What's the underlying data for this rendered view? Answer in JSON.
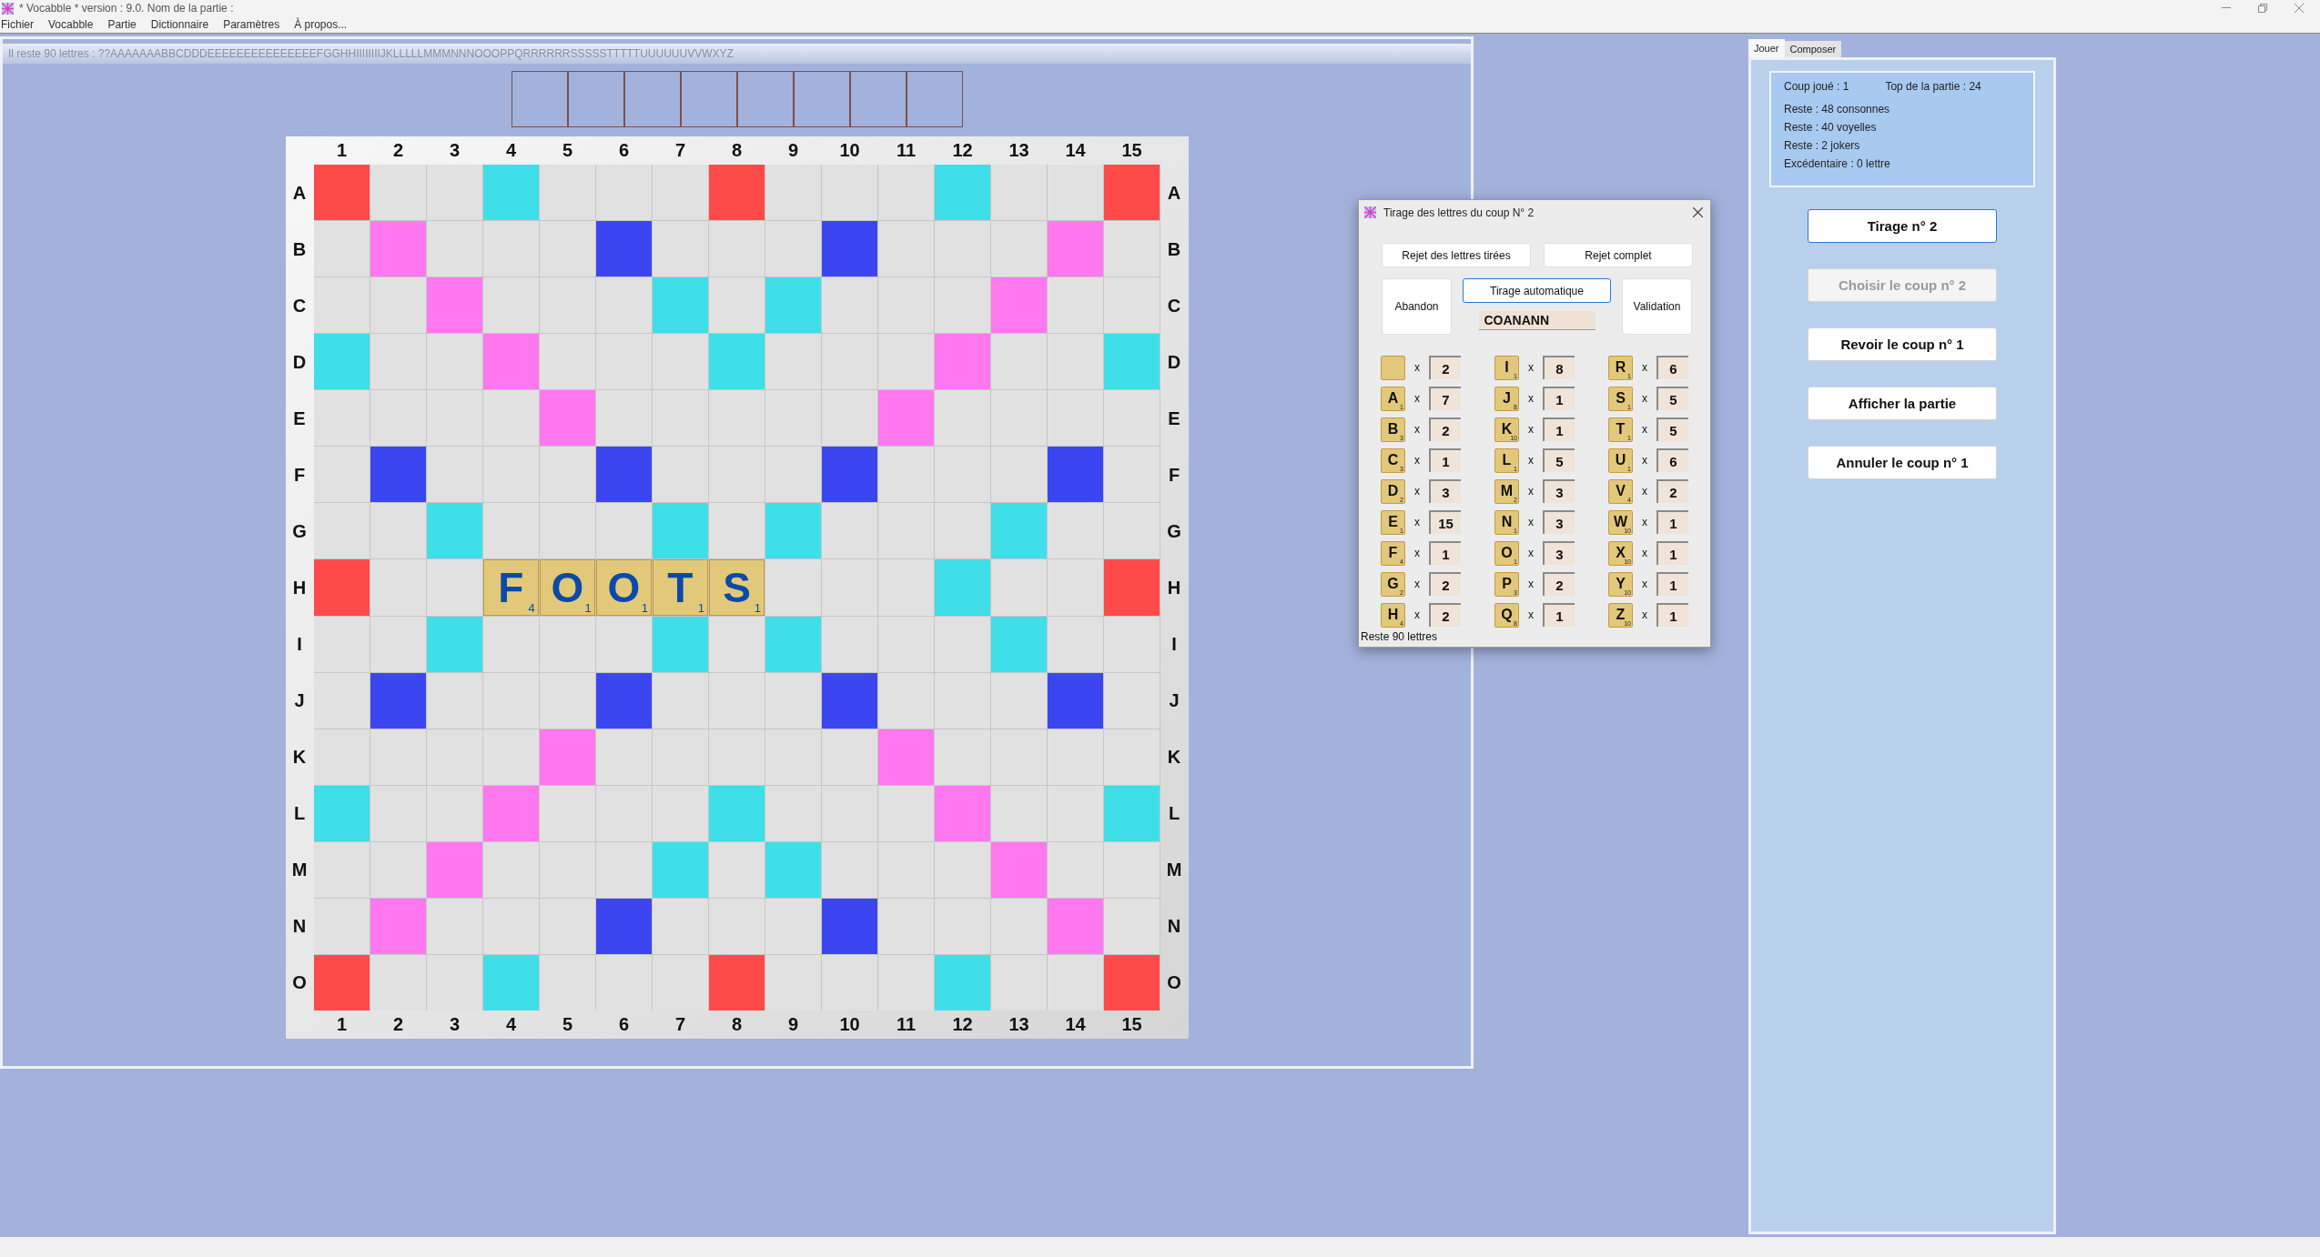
{
  "window": {
    "title": "* Vocabble * version : 9.0. Nom de la partie :"
  },
  "menu": [
    "Fichier",
    "Vocabble",
    "Partie",
    "Dictionnaire",
    "Paramètres",
    "À propos..."
  ],
  "remaining_letters": "Il reste 90 lettres : ??AAAAAAABBCDDDEEEEEEEEEEEEEEEFGGHHIIIIIIIIJKLLLLLMMMNNNOOOPPQRRRRRRSSSSSTTTTTUUUUUUVVWXYZ",
  "rack_slots": [
    {
      "kind": "empty"
    },
    {
      "kind": "empty"
    },
    {
      "kind": "empty"
    },
    {
      "kind": "empty"
    },
    {
      "kind": "empty"
    },
    {
      "kind": "empty"
    },
    {
      "kind": "empty"
    },
    {
      "kind": "empty"
    }
  ],
  "board": {
    "top_labels": [
      "1",
      "2",
      "3",
      "4",
      "5",
      "6",
      "7",
      "8",
      "9",
      "10",
      "11",
      "12",
      "13",
      "14",
      "15"
    ],
    "bottom_labels": [
      "1",
      "2",
      "3",
      "4",
      "5",
      "6",
      "7",
      "8",
      "9",
      "10",
      "11",
      "12",
      "13",
      "14",
      "15"
    ],
    "rows": [
      {
        "label_left": "A",
        "label_right": "A",
        "cells": [
          {
            "kind": "tw"
          },
          {
            "kind": "n"
          },
          {
            "kind": "n"
          },
          {
            "kind": "dl"
          },
          {
            "kind": "n"
          },
          {
            "kind": "n"
          },
          {
            "kind": "n"
          },
          {
            "kind": "tw"
          },
          {
            "kind": "n"
          },
          {
            "kind": "n"
          },
          {
            "kind": "n"
          },
          {
            "kind": "dl"
          },
          {
            "kind": "n"
          },
          {
            "kind": "n"
          },
          {
            "kind": "tw"
          }
        ]
      },
      {
        "label_left": "B",
        "label_right": "B",
        "cells": [
          {
            "kind": "n"
          },
          {
            "kind": "dw"
          },
          {
            "kind": "n"
          },
          {
            "kind": "n"
          },
          {
            "kind": "n"
          },
          {
            "kind": "tl"
          },
          {
            "kind": "n"
          },
          {
            "kind": "n"
          },
          {
            "kind": "n"
          },
          {
            "kind": "tl"
          },
          {
            "kind": "n"
          },
          {
            "kind": "n"
          },
          {
            "kind": "n"
          },
          {
            "kind": "dw"
          },
          {
            "kind": "n"
          }
        ]
      },
      {
        "label_left": "C",
        "label_right": "C",
        "cells": [
          {
            "kind": "n"
          },
          {
            "kind": "n"
          },
          {
            "kind": "dw"
          },
          {
            "kind": "n"
          },
          {
            "kind": "n"
          },
          {
            "kind": "n"
          },
          {
            "kind": "dl"
          },
          {
            "kind": "n"
          },
          {
            "kind": "dl"
          },
          {
            "kind": "n"
          },
          {
            "kind": "n"
          },
          {
            "kind": "n"
          },
          {
            "kind": "dw"
          },
          {
            "kind": "n"
          },
          {
            "kind": "n"
          }
        ]
      },
      {
        "label_left": "D",
        "label_right": "D",
        "cells": [
          {
            "kind": "dl"
          },
          {
            "kind": "n"
          },
          {
            "kind": "n"
          },
          {
            "kind": "dw"
          },
          {
            "kind": "n"
          },
          {
            "kind": "n"
          },
          {
            "kind": "n"
          },
          {
            "kind": "dl"
          },
          {
            "kind": "n"
          },
          {
            "kind": "n"
          },
          {
            "kind": "n"
          },
          {
            "kind": "dw"
          },
          {
            "kind": "n"
          },
          {
            "kind": "n"
          },
          {
            "kind": "dl"
          }
        ]
      },
      {
        "label_left": "E",
        "label_right": "E",
        "cells": [
          {
            "kind": "n"
          },
          {
            "kind": "n"
          },
          {
            "kind": "n"
          },
          {
            "kind": "n"
          },
          {
            "kind": "dw"
          },
          {
            "kind": "n"
          },
          {
            "kind": "n"
          },
          {
            "kind": "n"
          },
          {
            "kind": "n"
          },
          {
            "kind": "n"
          },
          {
            "kind": "dw"
          },
          {
            "kind": "n"
          },
          {
            "kind": "n"
          },
          {
            "kind": "n"
          },
          {
            "kind": "n"
          }
        ]
      },
      {
        "label_left": "F",
        "label_right": "F",
        "cells": [
          {
            "kind": "n"
          },
          {
            "kind": "tl"
          },
          {
            "kind": "n"
          },
          {
            "kind": "n"
          },
          {
            "kind": "n"
          },
          {
            "kind": "tl"
          },
          {
            "kind": "n"
          },
          {
            "kind": "n"
          },
          {
            "kind": "n"
          },
          {
            "kind": "tl"
          },
          {
            "kind": "n"
          },
          {
            "kind": "n"
          },
          {
            "kind": "n"
          },
          {
            "kind": "tl"
          },
          {
            "kind": "n"
          }
        ]
      },
      {
        "label_left": "G",
        "label_right": "G",
        "cells": [
          {
            "kind": "n"
          },
          {
            "kind": "n"
          },
          {
            "kind": "dl"
          },
          {
            "kind": "n"
          },
          {
            "kind": "n"
          },
          {
            "kind": "n"
          },
          {
            "kind": "dl"
          },
          {
            "kind": "n"
          },
          {
            "kind": "dl"
          },
          {
            "kind": "n"
          },
          {
            "kind": "n"
          },
          {
            "kind": "n"
          },
          {
            "kind": "dl"
          },
          {
            "kind": "n"
          },
          {
            "kind": "n"
          }
        ]
      },
      {
        "label_left": "H",
        "label_right": "H",
        "cells": [
          {
            "kind": "tw"
          },
          {
            "kind": "n"
          },
          {
            "kind": "n"
          },
          {
            "kind": "tile",
            "letter": "F",
            "points": "4"
          },
          {
            "kind": "tile",
            "letter": "O",
            "points": "1"
          },
          {
            "kind": "tile",
            "letter": "O",
            "points": "1"
          },
          {
            "kind": "tile",
            "letter": "T",
            "points": "1"
          },
          {
            "kind": "tile",
            "letter": "S",
            "points": "1"
          },
          {
            "kind": "n"
          },
          {
            "kind": "n"
          },
          {
            "kind": "n"
          },
          {
            "kind": "dl"
          },
          {
            "kind": "n"
          },
          {
            "kind": "n"
          },
          {
            "kind": "tw"
          }
        ]
      },
      {
        "label_left": "I",
        "label_right": "I",
        "cells": [
          {
            "kind": "n"
          },
          {
            "kind": "n"
          },
          {
            "kind": "dl"
          },
          {
            "kind": "n"
          },
          {
            "kind": "n"
          },
          {
            "kind": "n"
          },
          {
            "kind": "dl"
          },
          {
            "kind": "n"
          },
          {
            "kind": "dl"
          },
          {
            "kind": "n"
          },
          {
            "kind": "n"
          },
          {
            "kind": "n"
          },
          {
            "kind": "dl"
          },
          {
            "kind": "n"
          },
          {
            "kind": "n"
          }
        ]
      },
      {
        "label_left": "J",
        "label_right": "J",
        "cells": [
          {
            "kind": "n"
          },
          {
            "kind": "tl"
          },
          {
            "kind": "n"
          },
          {
            "kind": "n"
          },
          {
            "kind": "n"
          },
          {
            "kind": "tl"
          },
          {
            "kind": "n"
          },
          {
            "kind": "n"
          },
          {
            "kind": "n"
          },
          {
            "kind": "tl"
          },
          {
            "kind": "n"
          },
          {
            "kind": "n"
          },
          {
            "kind": "n"
          },
          {
            "kind": "tl"
          },
          {
            "kind": "n"
          }
        ]
      },
      {
        "label_left": "K",
        "label_right": "K",
        "cells": [
          {
            "kind": "n"
          },
          {
            "kind": "n"
          },
          {
            "kind": "n"
          },
          {
            "kind": "n"
          },
          {
            "kind": "dw"
          },
          {
            "kind": "n"
          },
          {
            "kind": "n"
          },
          {
            "kind": "n"
          },
          {
            "kind": "n"
          },
          {
            "kind": "n"
          },
          {
            "kind": "dw"
          },
          {
            "kind": "n"
          },
          {
            "kind": "n"
          },
          {
            "kind": "n"
          },
          {
            "kind": "n"
          }
        ]
      },
      {
        "label_left": "L",
        "label_right": "L",
        "cells": [
          {
            "kind": "dl"
          },
          {
            "kind": "n"
          },
          {
            "kind": "n"
          },
          {
            "kind": "dw"
          },
          {
            "kind": "n"
          },
          {
            "kind": "n"
          },
          {
            "kind": "n"
          },
          {
            "kind": "dl"
          },
          {
            "kind": "n"
          },
          {
            "kind": "n"
          },
          {
            "kind": "n"
          },
          {
            "kind": "dw"
          },
          {
            "kind": "n"
          },
          {
            "kind": "n"
          },
          {
            "kind": "dl"
          }
        ]
      },
      {
        "label_left": "M",
        "label_right": "M",
        "cells": [
          {
            "kind": "n"
          },
          {
            "kind": "n"
          },
          {
            "kind": "dw"
          },
          {
            "kind": "n"
          },
          {
            "kind": "n"
          },
          {
            "kind": "n"
          },
          {
            "kind": "dl"
          },
          {
            "kind": "n"
          },
          {
            "kind": "dl"
          },
          {
            "kind": "n"
          },
          {
            "kind": "n"
          },
          {
            "kind": "n"
          },
          {
            "kind": "dw"
          },
          {
            "kind": "n"
          },
          {
            "kind": "n"
          }
        ]
      },
      {
        "label_left": "N",
        "label_right": "N",
        "cells": [
          {
            "kind": "n"
          },
          {
            "kind": "dw"
          },
          {
            "kind": "n"
          },
          {
            "kind": "n"
          },
          {
            "kind": "n"
          },
          {
            "kind": "tl"
          },
          {
            "kind": "n"
          },
          {
            "kind": "n"
          },
          {
            "kind": "n"
          },
          {
            "kind": "tl"
          },
          {
            "kind": "n"
          },
          {
            "kind": "n"
          },
          {
            "kind": "n"
          },
          {
            "kind": "dw"
          },
          {
            "kind": "n"
          }
        ]
      },
      {
        "label_left": "O",
        "label_right": "O",
        "cells": [
          {
            "kind": "tw"
          },
          {
            "kind": "n"
          },
          {
            "kind": "n"
          },
          {
            "kind": "dl"
          },
          {
            "kind": "n"
          },
          {
            "kind": "n"
          },
          {
            "kind": "n"
          },
          {
            "kind": "tw"
          },
          {
            "kind": "n"
          },
          {
            "kind": "n"
          },
          {
            "kind": "n"
          },
          {
            "kind": "dl"
          },
          {
            "kind": "n"
          },
          {
            "kind": "n"
          },
          {
            "kind": "tw"
          }
        ]
      }
    ]
  },
  "dialog": {
    "title": "Tirage des lettres du coup N° 2",
    "buttons": [
      {
        "label": "Rejet des lettres tirées",
        "focused": false
      },
      {
        "label": "Rejet complet",
        "focused": false
      },
      {
        "label": "Abandon",
        "focused": false
      },
      {
        "label": "Tirage automatique",
        "focused": true
      },
      {
        "label": "Validation",
        "focused": false
      }
    ],
    "draw_field": {
      "value": "COANANN"
    },
    "letters": [
      {
        "kind": "blank",
        "times": "x",
        "count": "2"
      },
      {
        "kind": "letter",
        "letter": "A",
        "points": "1",
        "times": "x",
        "count": "7"
      },
      {
        "kind": "letter",
        "letter": "B",
        "points": "3",
        "times": "x",
        "count": "2"
      },
      {
        "kind": "letter",
        "letter": "C",
        "points": "3",
        "times": "x",
        "count": "1"
      },
      {
        "kind": "letter",
        "letter": "D",
        "points": "2",
        "times": "x",
        "count": "3"
      },
      {
        "kind": "letter",
        "letter": "E",
        "points": "1",
        "times": "x",
        "count": "15"
      },
      {
        "kind": "letter",
        "letter": "F",
        "points": "4",
        "times": "x",
        "count": "1"
      },
      {
        "kind": "letter",
        "letter": "G",
        "points": "2",
        "times": "x",
        "count": "2"
      },
      {
        "kind": "letter",
        "letter": "H",
        "points": "4",
        "times": "x",
        "count": "2"
      },
      {
        "kind": "letter",
        "letter": "I",
        "points": "1",
        "times": "x",
        "count": "8"
      },
      {
        "kind": "letter",
        "letter": "J",
        "points": "8",
        "times": "x",
        "count": "1"
      },
      {
        "kind": "letter",
        "letter": "K",
        "points": "10",
        "times": "x",
        "count": "1"
      },
      {
        "kind": "letter",
        "letter": "L",
        "points": "1",
        "times": "x",
        "count": "5"
      },
      {
        "kind": "letter",
        "letter": "M",
        "points": "2",
        "times": "x",
        "count": "3"
      },
      {
        "kind": "letter",
        "letter": "N",
        "points": "1",
        "times": "x",
        "count": "3"
      },
      {
        "kind": "letter",
        "letter": "O",
        "points": "1",
        "times": "x",
        "count": "3"
      },
      {
        "kind": "letter",
        "letter": "P",
        "points": "3",
        "times": "x",
        "count": "2"
      },
      {
        "kind": "letter",
        "letter": "Q",
        "points": "8",
        "times": "x",
        "count": "1"
      },
      {
        "kind": "letter",
        "letter": "R",
        "points": "1",
        "times": "x",
        "count": "6"
      },
      {
        "kind": "letter",
        "letter": "S",
        "points": "1",
        "times": "x",
        "count": "5"
      },
      {
        "kind": "letter",
        "letter": "T",
        "points": "1",
        "times": "x",
        "count": "5"
      },
      {
        "kind": "letter",
        "letter": "U",
        "points": "1",
        "times": "x",
        "count": "6"
      },
      {
        "kind": "letter",
        "letter": "V",
        "points": "4",
        "times": "x",
        "count": "2"
      },
      {
        "kind": "letter",
        "letter": "W",
        "points": "10",
        "times": "x",
        "count": "1"
      },
      {
        "kind": "letter",
        "letter": "X",
        "points": "10",
        "times": "x",
        "count": "1"
      },
      {
        "kind": "letter",
        "letter": "Y",
        "points": "10",
        "times": "x",
        "count": "1"
      },
      {
        "kind": "letter",
        "letter": "Z",
        "points": "10",
        "times": "x",
        "count": "1"
      }
    ],
    "status": "Reste 90 lettres"
  },
  "tabs": [
    {
      "label": "Jouer",
      "selected": true
    },
    {
      "label": "Composer",
      "selected": false
    }
  ],
  "panel": {
    "info": {
      "move_played": "Coup joué : 1",
      "top_score": "Top de la partie : 24",
      "lines": [
        "Reste : 48 consonnes",
        "Reste : 40 voyelles",
        "Reste : 2 jokers",
        "Excédentaire : 0 lettre"
      ]
    },
    "buttons": [
      {
        "label": "Tirage n° 2",
        "focused": true,
        "disabled": false
      },
      {
        "label": "Choisir le coup n° 2",
        "focused": false,
        "disabled": true
      },
      {
        "label": "Revoir le coup n° 1",
        "focused": false,
        "disabled": false
      },
      {
        "label": "Afficher la partie",
        "focused": false,
        "disabled": false
      },
      {
        "label": "Annuler le coup n° 1",
        "focused": false,
        "disabled": false
      }
    ]
  }
}
